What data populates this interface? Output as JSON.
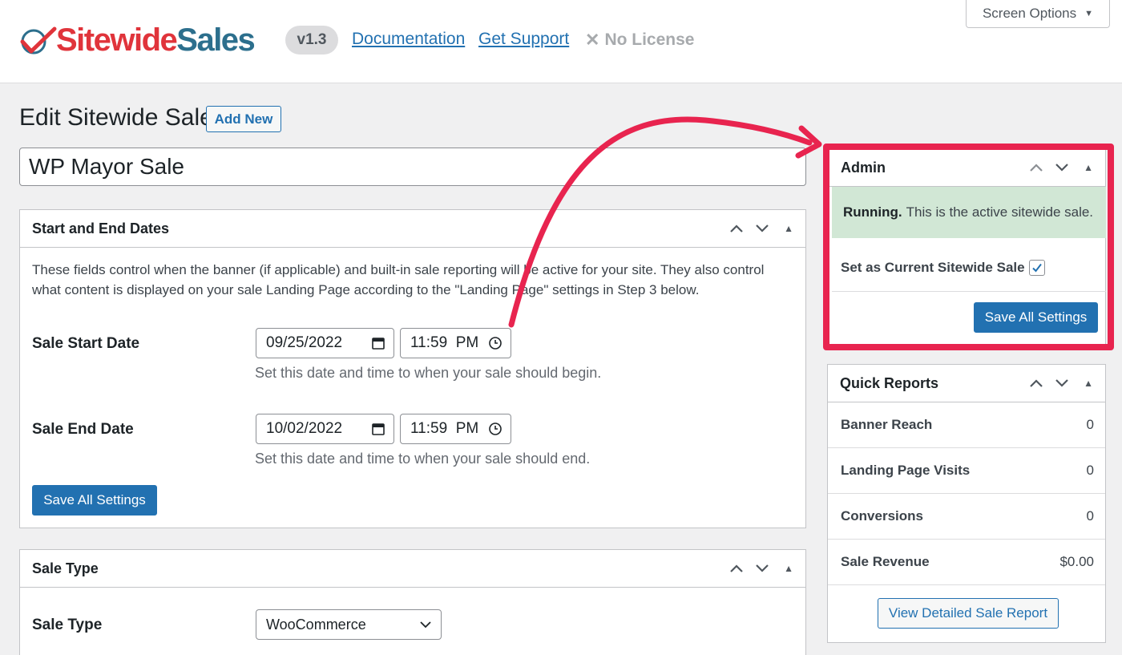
{
  "header": {
    "logo_part1": "Sitewide",
    "logo_part2": "Sales",
    "version": "v1.3",
    "documentation_link": "Documentation",
    "support_link": "Get Support",
    "license_status": "No License",
    "screen_options": "Screen Options"
  },
  "page": {
    "title": "Edit Sitewide Sale",
    "add_new": "Add New",
    "sale_name": "WP Mayor Sale"
  },
  "dates_box": {
    "title": "Start and End Dates",
    "description": "These fields control when the banner (if applicable) and built-in sale reporting will be active for your site. They also control what content is displayed on your sale Landing Page according to the \"Landing Page\" settings in Step 3 below.",
    "start_label": "Sale Start Date",
    "start_date": "09/25/2022",
    "start_time": "11:59  PM",
    "start_hint": "Set this date and time to when your sale should begin.",
    "end_label": "Sale End Date",
    "end_date": "10/02/2022",
    "end_time": "11:59  PM",
    "end_hint": "Set this date and time to when your sale should end.",
    "save_button": "Save All Settings"
  },
  "sale_type_box": {
    "title": "Sale Type",
    "label": "Sale Type",
    "selected": "WooCommerce"
  },
  "admin_box": {
    "title": "Admin",
    "status_bold": "Running.",
    "status_text": "This is the active sitewide sale.",
    "set_current_label": "Set as Current Sitewide Sale",
    "set_current_checked": true,
    "save_button": "Save All Settings"
  },
  "quick_reports": {
    "title": "Quick Reports",
    "rows": [
      {
        "label": "Banner Reach",
        "value": "0"
      },
      {
        "label": "Landing Page Visits",
        "value": "0"
      },
      {
        "label": "Conversions",
        "value": "0"
      },
      {
        "label": "Sale Revenue",
        "value": "$0.00"
      }
    ],
    "detail_button": "View Detailed Sale Report"
  },
  "colors": {
    "primary": "#2271b1",
    "highlight": "#e8244f",
    "running_bg": "#d1e7d5",
    "logo_red": "#e0343b",
    "logo_blue": "#2c6f8d"
  },
  "icons": [
    "checkmark-logo-icon",
    "close-icon",
    "caret-down-icon",
    "chevron-up-icon",
    "chevron-down-icon",
    "toggle-icon",
    "calendar-icon",
    "clock-icon",
    "checkbox-check-icon",
    "arrow-annotation"
  ]
}
